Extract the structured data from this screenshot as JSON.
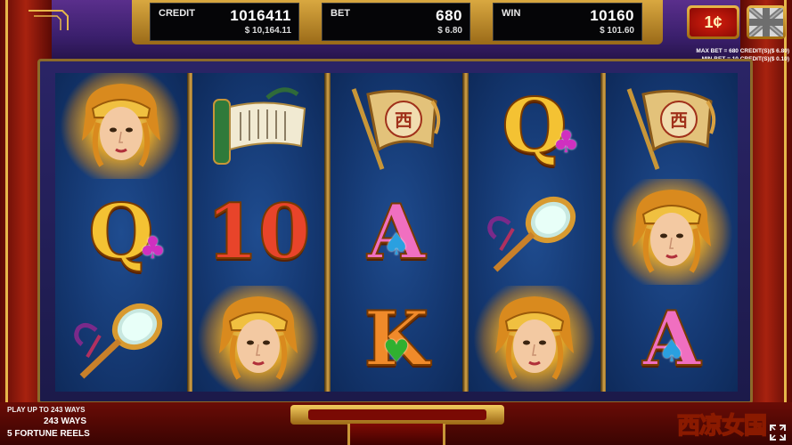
{
  "hud": {
    "credit": {
      "label": "CREDIT",
      "value": "1016411",
      "money": "$ 10,164.11"
    },
    "bet": {
      "label": "BET",
      "value": "680",
      "money": "$ 6.80"
    },
    "win": {
      "label": "WIN",
      "value": "10160",
      "money": "$ 101.60"
    },
    "denomination": "1¢",
    "language_icon": "union-jack-flag-icon"
  },
  "bet_info": {
    "line1": "MAX BET = 680 CREDIT(S)($ 6.80)",
    "line2": "MIN BET = 10 CREDIT(S)($ 0.10)"
  },
  "reels": [
    [
      "warrior-queen",
      "queen-clubs",
      "mirror"
    ],
    [
      "scroll",
      "ten",
      "warrior-queen"
    ],
    [
      "banner",
      "ace-spades",
      "king-hearts"
    ],
    [
      "queen-clubs",
      "mirror",
      "warrior-queen"
    ],
    [
      "banner",
      "warrior-queen",
      "ace-spades"
    ]
  ],
  "winning_positions": [
    [
      0,
      0
    ],
    [
      1,
      2
    ],
    [
      3,
      2
    ],
    [
      4,
      1
    ]
  ],
  "symbol_text": {
    "queen": "Q",
    "ten": "10",
    "ace": "A",
    "king": "K"
  },
  "footer": {
    "line1": "PLAY UP TO 243 WAYS",
    "line2": "243 WAYS",
    "line3": "5 FORTUNE REELS",
    "logo": "西凉女国"
  },
  "colors": {
    "hud_gold": "#d9a840",
    "reel_blue": "#143770",
    "glow": "#ffcc33",
    "denom_red": "#d71e0e"
  }
}
